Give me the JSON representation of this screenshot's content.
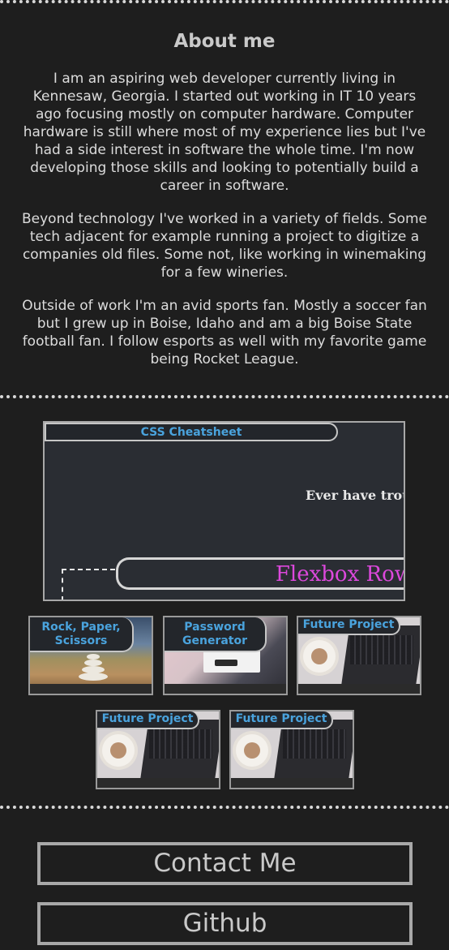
{
  "about": {
    "title": "About me",
    "paragraphs": [
      "I am an aspiring web developer currently living in Kennesaw, Georgia. I started out working in IT 10 years ago focusing mostly on computer hardware. Computer hardware is still where most of my experience lies but I've had a side interest in software the whole time. I'm now developing those skills and looking to potentially build a career in software.",
      "Beyond technology I've worked in a variety of fields. Some tech adjacent for example running a project to digitize a companies old files. Some not, like working in winemaking for a few wineries.",
      "Outside of work I'm an avid sports fan. Mostly a soccer fan but I grew up in Boise, Idaho and am a big Boise State football fan. I follow esports as well with my favorite game being Rocket League."
    ]
  },
  "featured": {
    "label": "CSS Cheatsheet",
    "preview_heading": "Ever have trou",
    "preview_box_label": "Flexbox Row"
  },
  "projects": [
    {
      "label": "Rock, Paper, Scissors"
    },
    {
      "label": "Password Generator"
    },
    {
      "label": "Future Project"
    },
    {
      "label": "Future Project"
    },
    {
      "label": "Future Project"
    }
  ],
  "links": {
    "contact": "Contact Me",
    "github": "Github"
  },
  "colors": {
    "background": "#1e1e1e",
    "accent": "#4aa3dd",
    "flexbox_label": "#dc48dc"
  }
}
